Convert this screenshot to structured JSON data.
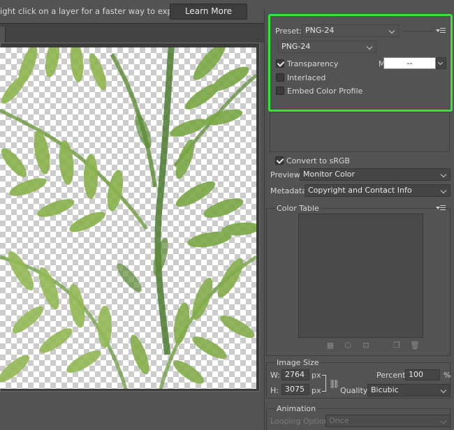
{
  "topbar": {
    "hint": "ight click on a layer for a faster way to export assets",
    "learn_more": "Learn More"
  },
  "preset": {
    "label": "Preset:",
    "value": "PNG-24",
    "menu_icon": "panel-menu-icon"
  },
  "format": {
    "value": "PNG-24"
  },
  "options": {
    "transparency": {
      "label": "Transparency",
      "checked": true
    },
    "interlaced": {
      "label": "Interlaced",
      "checked": false
    },
    "embed_profile": {
      "label": "Embed Color Profile",
      "checked": false
    },
    "matte": {
      "label": "Matte:",
      "value": "--"
    }
  },
  "convert": {
    "label": "Convert to sRGB",
    "checked": true
  },
  "preview": {
    "label": "Preview:",
    "value": "Monitor Color"
  },
  "metadata": {
    "label": "Metadata:",
    "value": "Copyright and Contact Info"
  },
  "color_table": {
    "title": "Color Table",
    "icons": [
      "map-to-web-icon",
      "web-shift-icon",
      "lock-color-icon",
      "new-color-icon",
      "trash-icon"
    ]
  },
  "image_size": {
    "title": "Image Size",
    "w_label": "W:",
    "w_value": "2764",
    "h_label": "H:",
    "h_value": "3075",
    "unit": "px",
    "percent_label": "Percent:",
    "percent_value": "100",
    "percent_unit": "%",
    "quality_label": "Quality:",
    "quality_value": "Bicubic"
  },
  "animation": {
    "title": "Animation",
    "looping_label": "Looping Options:",
    "looping_value": "Once"
  },
  "colors": {
    "highlight": "#35e33a",
    "panel_bg": "#535353",
    "leaf_dark": "#4f7a2c",
    "leaf_light": "#9fc25a"
  }
}
